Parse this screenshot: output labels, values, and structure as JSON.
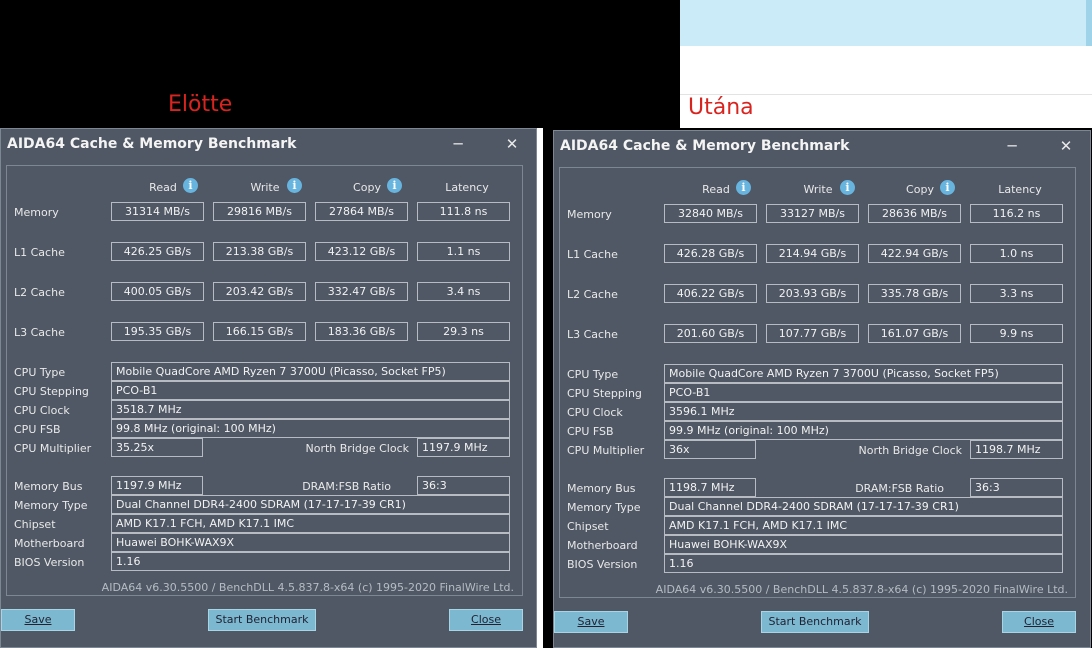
{
  "captions": {
    "before": "Elötte",
    "after": "Utána"
  },
  "app": {
    "title": "AIDA64 Cache & Memory Benchmark",
    "minimize_icon": "minimize-icon",
    "close_icon": "close-icon"
  },
  "headers": {
    "read": "Read",
    "write": "Write",
    "copy": "Copy",
    "latency": "Latency"
  },
  "labels": {
    "memory": "Memory",
    "l1": "L1 Cache",
    "l2": "L2 Cache",
    "l3": "L3 Cache",
    "cpu_type": "CPU Type",
    "cpu_stepping": "CPU Stepping",
    "cpu_clock": "CPU Clock",
    "cpu_fsb": "CPU FSB",
    "cpu_multiplier": "CPU Multiplier",
    "nb_clock": "North Bridge Clock",
    "memory_bus": "Memory Bus",
    "dram_ratio": "DRAM:FSB Ratio",
    "memory_type": "Memory Type",
    "chipset": "Chipset",
    "motherboard": "Motherboard",
    "bios": "BIOS Version"
  },
  "buttons": {
    "save": "Save",
    "start": "Start Benchmark",
    "close": "Close"
  },
  "windows": [
    {
      "memory": [
        "31314 MB/s",
        "29816 MB/s",
        "27864 MB/s",
        "111.8 ns"
      ],
      "l1": [
        "426.25 GB/s",
        "213.38 GB/s",
        "423.12 GB/s",
        "1.1 ns"
      ],
      "l2": [
        "400.05 GB/s",
        "203.42 GB/s",
        "332.47 GB/s",
        "3.4 ns"
      ],
      "l3": [
        "195.35 GB/s",
        "166.15 GB/s",
        "183.36 GB/s",
        "29.3 ns"
      ],
      "cpu_type": "Mobile QuadCore AMD Ryzen 7 3700U  (Picasso, Socket FP5)",
      "cpu_stepping": "PCO-B1",
      "cpu_clock": "3518.7 MHz",
      "cpu_fsb": "99.8 MHz  (original: 100 MHz)",
      "cpu_multiplier": "35.25x",
      "nb_clock": "1197.9 MHz",
      "memory_bus": "1197.9 MHz",
      "dram_ratio": "36:3",
      "memory_type": "Dual Channel DDR4-2400 SDRAM  (17-17-17-39 CR1)",
      "chipset": "AMD K17.1 FCH, AMD K17.1 IMC",
      "motherboard": "Huawei BOHK-WAX9X",
      "bios": "1.16",
      "footer": "AIDA64 v6.30.5500 / BenchDLL 4.5.837.8-x64  (c) 1995-2020 FinalWire Ltd."
    },
    {
      "memory": [
        "32840 MB/s",
        "33127 MB/s",
        "28636 MB/s",
        "116.2 ns"
      ],
      "l1": [
        "426.28 GB/s",
        "214.94 GB/s",
        "422.94 GB/s",
        "1.0 ns"
      ],
      "l2": [
        "406.22 GB/s",
        "203.93 GB/s",
        "335.78 GB/s",
        "3.3 ns"
      ],
      "l3": [
        "201.60 GB/s",
        "107.77 GB/s",
        "161.07 GB/s",
        "9.9 ns"
      ],
      "cpu_type": "Mobile QuadCore AMD Ryzen 7 3700U  (Picasso, Socket FP5)",
      "cpu_stepping": "PCO-B1",
      "cpu_clock": "3596.1 MHz",
      "cpu_fsb": "99.9 MHz  (original: 100 MHz)",
      "cpu_multiplier": "36x",
      "nb_clock": "1198.7 MHz",
      "memory_bus": "1198.7 MHz",
      "dram_ratio": "36:3",
      "memory_type": "Dual Channel DDR4-2400 SDRAM  (17-17-17-39 CR1)",
      "chipset": "AMD K17.1 FCH, AMD K17.1 IMC",
      "motherboard": "Huawei BOHK-WAX9X",
      "bios": "1.16",
      "footer": "AIDA64 v6.30.5500 / BenchDLL 4.5.837.8-x64  (c) 1995-2020 FinalWire Ltd."
    }
  ]
}
